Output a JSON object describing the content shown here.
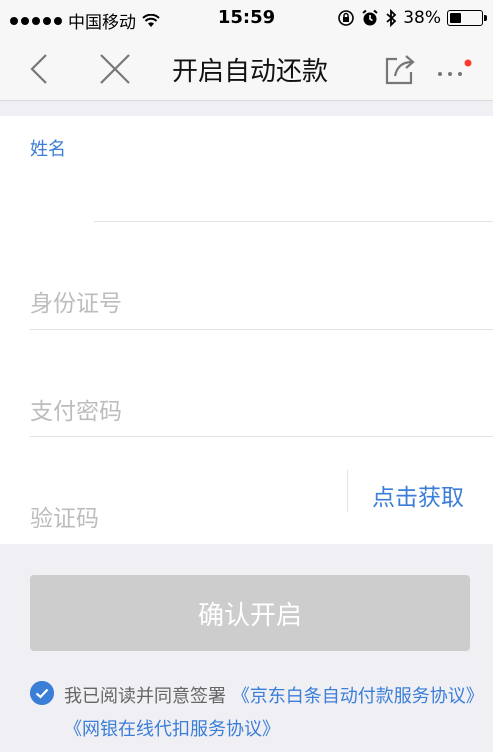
{
  "status_bar": {
    "carrier": "中国移动",
    "time": "15:59",
    "battery": "38%",
    "battery_level": 0.38
  },
  "nav": {
    "title": "开启自动还款"
  },
  "form": {
    "name_label": "姓名",
    "id_placeholder": "身份证号",
    "password_placeholder": "支付密码",
    "code_placeholder": "验证码",
    "get_code_label": "点击获取"
  },
  "confirm": {
    "label": "确认开启"
  },
  "agreement": {
    "prefix": "我已阅读并同意签署",
    "link1": "《京东白条自动付款服务协议》",
    "link2": "《网银在线代扣服务协议》"
  },
  "colors": {
    "accent": "#3b7ed8",
    "disabled_button": "#cdcdcd",
    "background": "#efeff4",
    "unread_dot": "#ff3b30"
  }
}
